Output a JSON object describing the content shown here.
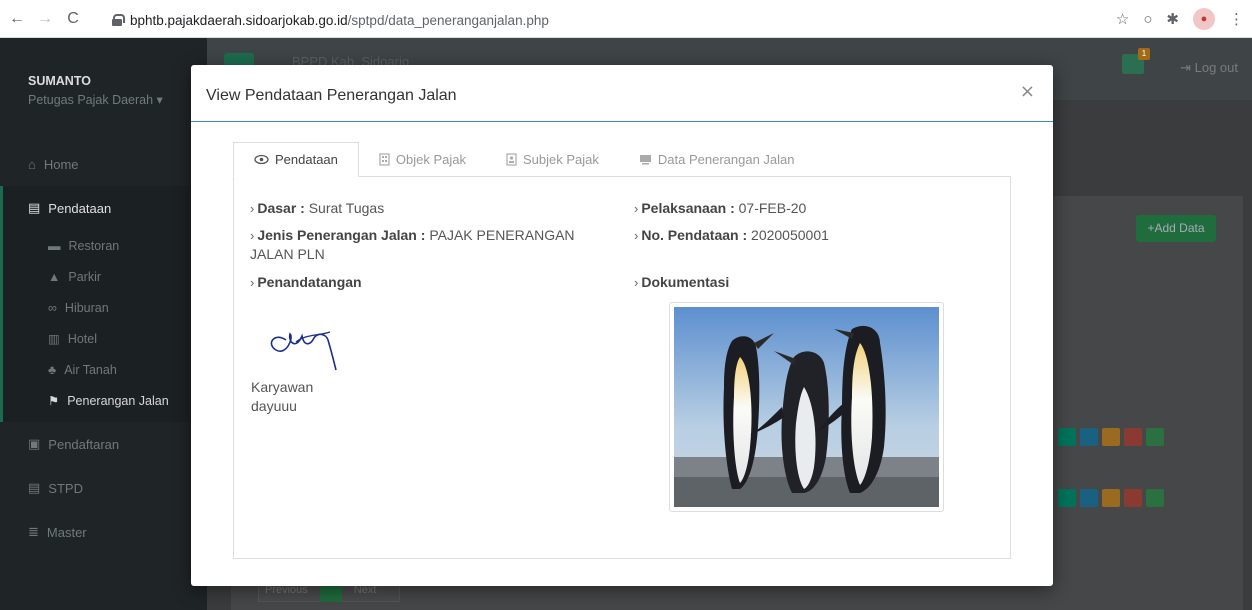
{
  "browser": {
    "url_host": "bphtb.pajakdaerah.sidoarjokab.go.id",
    "url_path": "/sptpd/data_peneranganjalan.php"
  },
  "sidebar": {
    "user_name": "SUMANTO",
    "user_role": "Petugas Pajak Daerah ▾",
    "items": [
      {
        "label": "Home"
      },
      {
        "label": "Pendataan"
      },
      {
        "label": "Pendaftaran"
      },
      {
        "label": "STPD"
      },
      {
        "label": "Master"
      }
    ],
    "sub_items": [
      {
        "label": "Restoran"
      },
      {
        "label": "Parkir"
      },
      {
        "label": "Hiburan"
      },
      {
        "label": "Hotel"
      },
      {
        "label": "Air Tanah"
      },
      {
        "label": "Penerangan Jalan"
      }
    ]
  },
  "topbar": {
    "brand": "BPPD Kab. Sidoarjo",
    "notif_count": "1",
    "logout_label": "Log out"
  },
  "page": {
    "add_data_label": "Add Data",
    "pager_prev": "Previous",
    "pager_next": "Next"
  },
  "modal": {
    "title": "View Pendataan Penerangan Jalan",
    "close": "×",
    "tabs": [
      {
        "label": "Pendataan",
        "icon": "eye-icon"
      },
      {
        "label": "Objek Pajak",
        "icon": "building-icon"
      },
      {
        "label": "Subjek Pajak",
        "icon": "id-card-icon"
      },
      {
        "label": "Data Penerangan Jalan",
        "icon": "monitor-icon"
      }
    ],
    "fields": {
      "dasar_label": "Dasar :",
      "dasar_value": "Surat Tugas",
      "pelaksanaan_label": "Pelaksanaan :",
      "pelaksanaan_value": "07-FEB-20",
      "jenis_label": "Jenis Penerangan Jalan :",
      "jenis_value": "PAJAK PENERANGAN JALAN PLN",
      "no_label": "No. Pendataan :",
      "no_value": "2020050001",
      "penandatangan_label": "Penandatangan",
      "dokumentasi_label": "Dokumentasi",
      "signer_position": "Karyawan",
      "signer_name": "dayuuu"
    }
  },
  "colors": {
    "primary_border": "#3c8dbc",
    "sidebar_bg": "#1f2426",
    "green": "#00a65a"
  }
}
